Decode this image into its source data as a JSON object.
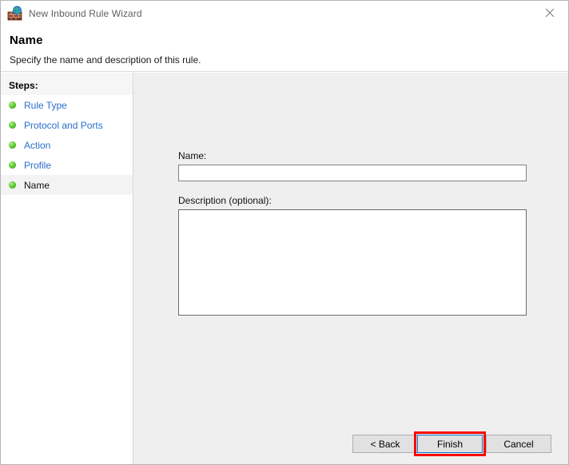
{
  "window": {
    "title": "New Inbound Rule Wizard",
    "icon": "firewall-brick-wall-globe-icon",
    "close_label": "✕"
  },
  "header": {
    "title": "Name",
    "subtitle": "Specify the name and description of this rule."
  },
  "sidebar": {
    "steps_label": "Steps:",
    "items": [
      {
        "label": "Rule Type",
        "state": "completed"
      },
      {
        "label": "Protocol and Ports",
        "state": "completed"
      },
      {
        "label": "Action",
        "state": "completed"
      },
      {
        "label": "Profile",
        "state": "completed"
      },
      {
        "label": "Name",
        "state": "current"
      }
    ]
  },
  "form": {
    "name_label": "Name:",
    "name_value": "",
    "name_placeholder": "",
    "description_label": "Description (optional):",
    "description_value": "",
    "description_placeholder": ""
  },
  "buttons": {
    "back": "< Back",
    "finish": "Finish",
    "cancel": "Cancel"
  },
  "colors": {
    "link": "#2a6ecb",
    "step_bullet": "#62d13a",
    "content_bg": "#efefef",
    "button_bg": "#e1e1e1",
    "focus_border": "#0078d7",
    "annotation_highlight": "#fe0000"
  }
}
